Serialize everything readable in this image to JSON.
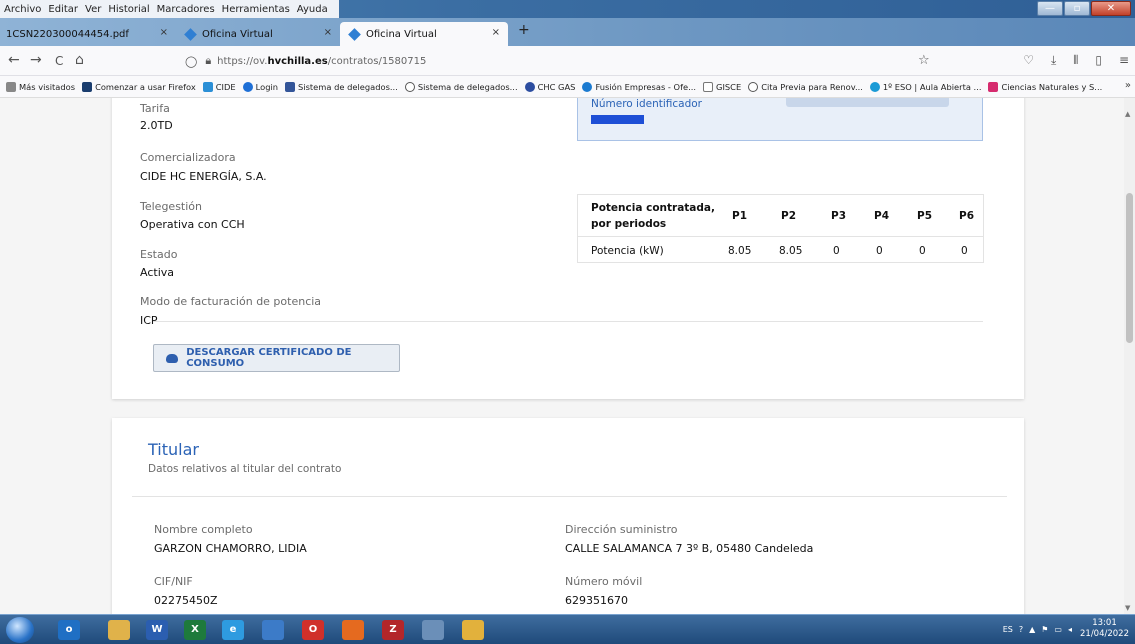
{
  "menu": [
    "Archivo",
    "Editar",
    "Ver",
    "Historial",
    "Marcadores",
    "Herramientas",
    "Ayuda"
  ],
  "tabs": [
    {
      "label": "1CSN220300044454.pdf",
      "close": "×"
    },
    {
      "label": "Oficina Virtual",
      "close": "×"
    },
    {
      "label": "Oficina Virtual",
      "close": "×"
    }
  ],
  "new_tab": "+",
  "window_controls": {
    "min": "—",
    "max": "▫",
    "close": "✕"
  },
  "nav": {
    "back": "←",
    "forward": "→",
    "reload": "C",
    "home": "⌂"
  },
  "url": {
    "prefix": "https://ov.",
    "domain": "hvchilla.es",
    "path": "/contratos/1580715"
  },
  "bookmarks": [
    {
      "label": "Más visitados",
      "color": "#888888"
    },
    {
      "label": "Comenzar a usar Firefox",
      "color": "#1a3d6e"
    },
    {
      "label": "CIDE",
      "color": "#2b8fd6"
    },
    {
      "label": "Login",
      "color": "#1e6fd6"
    },
    {
      "label": "Sistema de delegados...",
      "color": "#335599"
    },
    {
      "label": "Sistema de delegados...",
      "color": "#555555"
    },
    {
      "label": "CHC GAS",
      "color": "#2c4da0"
    },
    {
      "label": "Fusión Empresas - Ofe...",
      "color": "#1b7ad0"
    },
    {
      "label": "GISCE",
      "color": "#777777"
    },
    {
      "label": "Cita Previa para Renov...",
      "color": "#555555"
    },
    {
      "label": "1º ESO | Aula Abierta ...",
      "color": "#1a9ad6"
    },
    {
      "label": "Ciencias Naturales y S...",
      "color": "#d62b6e"
    }
  ],
  "bookmarks_more": "»",
  "contract": {
    "tarifa_label": "Tarifa",
    "tarifa_value": "2.0TD",
    "comercializadora_label": "Comercializadora",
    "comercializadora_value": "CIDE HC ENERGÍA, S.A.",
    "telegestion_label": "Telegestión",
    "telegestion_value": "Operativa con CCH",
    "estado_label": "Estado",
    "estado_value": "Activa",
    "modo_label": "Modo de facturación de potencia",
    "modo_value": "ICP",
    "identificador_label": "Número identificador",
    "download_label": "DESCARGAR CERTIFICADO DE CONSUMO"
  },
  "potencia_table": {
    "header_line1": "Potencia contratada,",
    "header_line2": "por periodos",
    "periods": [
      "P1",
      "P2",
      "P3",
      "P4",
      "P5",
      "P6"
    ],
    "row_label": "Potencia (kW)",
    "values": [
      "8.05",
      "8.05",
      "0",
      "0",
      "0",
      "0"
    ]
  },
  "titular": {
    "title": "Titular",
    "subtitle": "Datos relativos al titular del contrato",
    "nombre_label": "Nombre completo",
    "nombre_value": "GARZON CHAMORRO, LIDIA",
    "direccion_label": "Dirección suministro",
    "direccion_value": "CALLE SALAMANCA 7 3º B, 05480 Candeleda",
    "cif_label": "CIF/NIF",
    "cif_value": "02275450Z",
    "movil_label": "Número móvil",
    "movil_value": "629351670"
  },
  "taskbar": {
    "apps": [
      {
        "name": "outlook",
        "glyph": "o",
        "color": "#1f6fc4"
      },
      {
        "name": "explorer",
        "glyph": "",
        "color": "#e0b24a"
      },
      {
        "name": "word",
        "glyph": "W",
        "color": "#2b5eb0"
      },
      {
        "name": "excel",
        "glyph": "X",
        "color": "#1e7a3c"
      },
      {
        "name": "ie",
        "glyph": "e",
        "color": "#2e9be0"
      },
      {
        "name": "network",
        "glyph": "",
        "color": "#3c7bc8"
      },
      {
        "name": "opera",
        "glyph": "O",
        "color": "#d0302a"
      },
      {
        "name": "firefox",
        "glyph": "",
        "color": "#e56a1f"
      },
      {
        "name": "filezilla",
        "glyph": "Z",
        "color": "#b3262a"
      },
      {
        "name": "misc",
        "glyph": "",
        "color": "#6b8fb8"
      },
      {
        "name": "chrome",
        "glyph": "",
        "color": "#e2b13c"
      }
    ],
    "lang": "ES",
    "time": "13:01",
    "date": "21/04/2022"
  }
}
